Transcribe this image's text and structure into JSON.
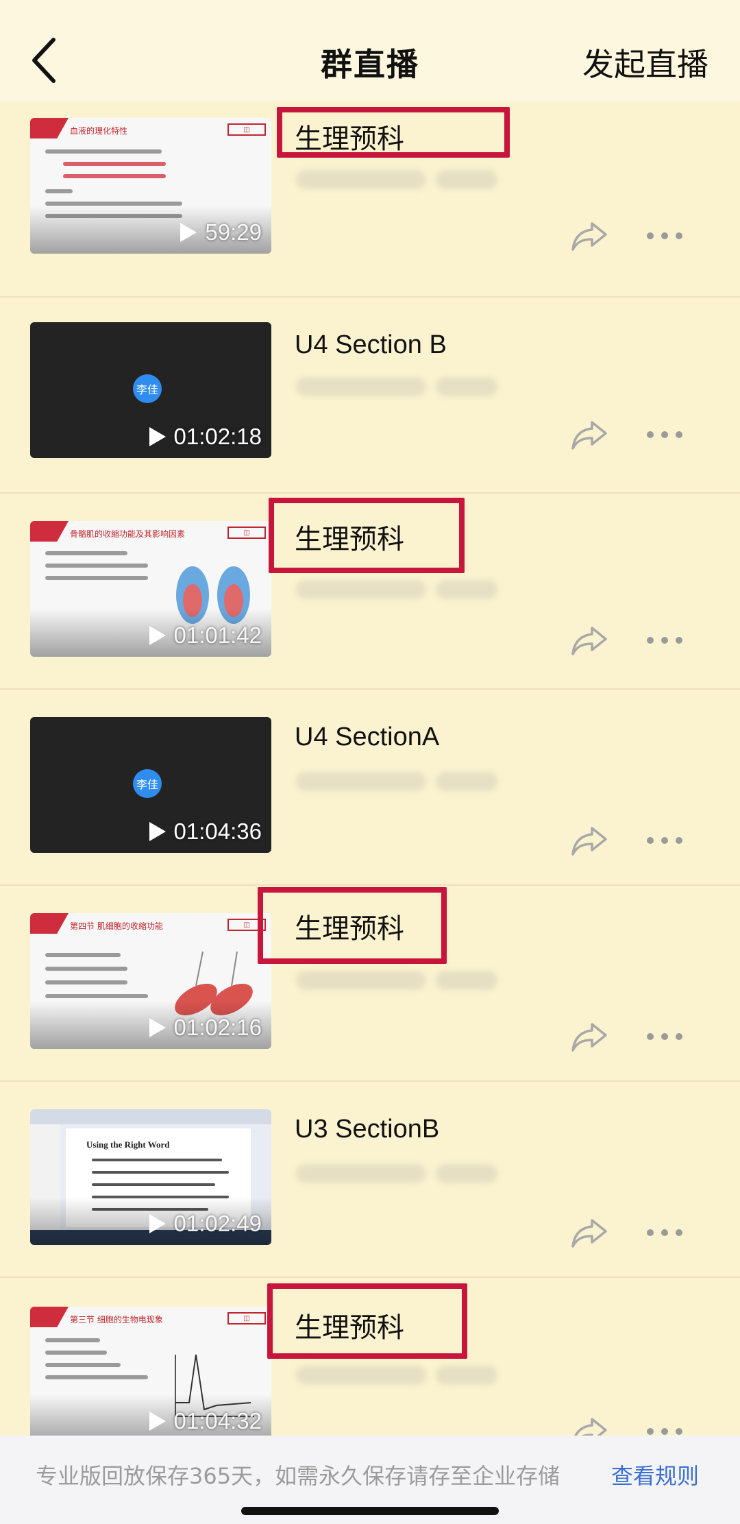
{
  "header": {
    "title": "群直播",
    "action": "发起直播"
  },
  "items": [
    {
      "title": "生理预科",
      "duration": "59:29",
      "thumb_heading": "血液的理化特性",
      "highlighted": true
    },
    {
      "title": "U4 Section B",
      "duration": "01:02:18",
      "avatar": "李佳",
      "highlighted": false
    },
    {
      "title": "生理预科",
      "duration": "01:01:42",
      "thumb_heading": "骨骼肌的收缩功能及其影响因素",
      "highlighted": true
    },
    {
      "title": "U4 SectionA",
      "duration": "01:04:36",
      "avatar": "李佳",
      "highlighted": false
    },
    {
      "title": "生理预科",
      "duration": "01:02:16",
      "thumb_heading": "第四节 肌细胞的收缩功能",
      "highlighted": true
    },
    {
      "title": "U3 SectionB",
      "duration": "01:02:49",
      "thumb_heading": "Using the Right Word",
      "highlighted": false
    },
    {
      "title": "生理预科",
      "duration": "01:04:32",
      "thumb_heading": "第三节 细胞的生物电现象",
      "highlighted": true
    }
  ],
  "footer": {
    "notice": "专业版回放保存365天，如需永久保存请存至企业存储",
    "link": "查看规则"
  },
  "colors": {
    "background": "#fbf3cf",
    "highlight": "#c8153c",
    "link": "#3b6fd1"
  },
  "icons": [
    "back-chevron-icon",
    "play-icon",
    "share-icon",
    "more-icon"
  ]
}
